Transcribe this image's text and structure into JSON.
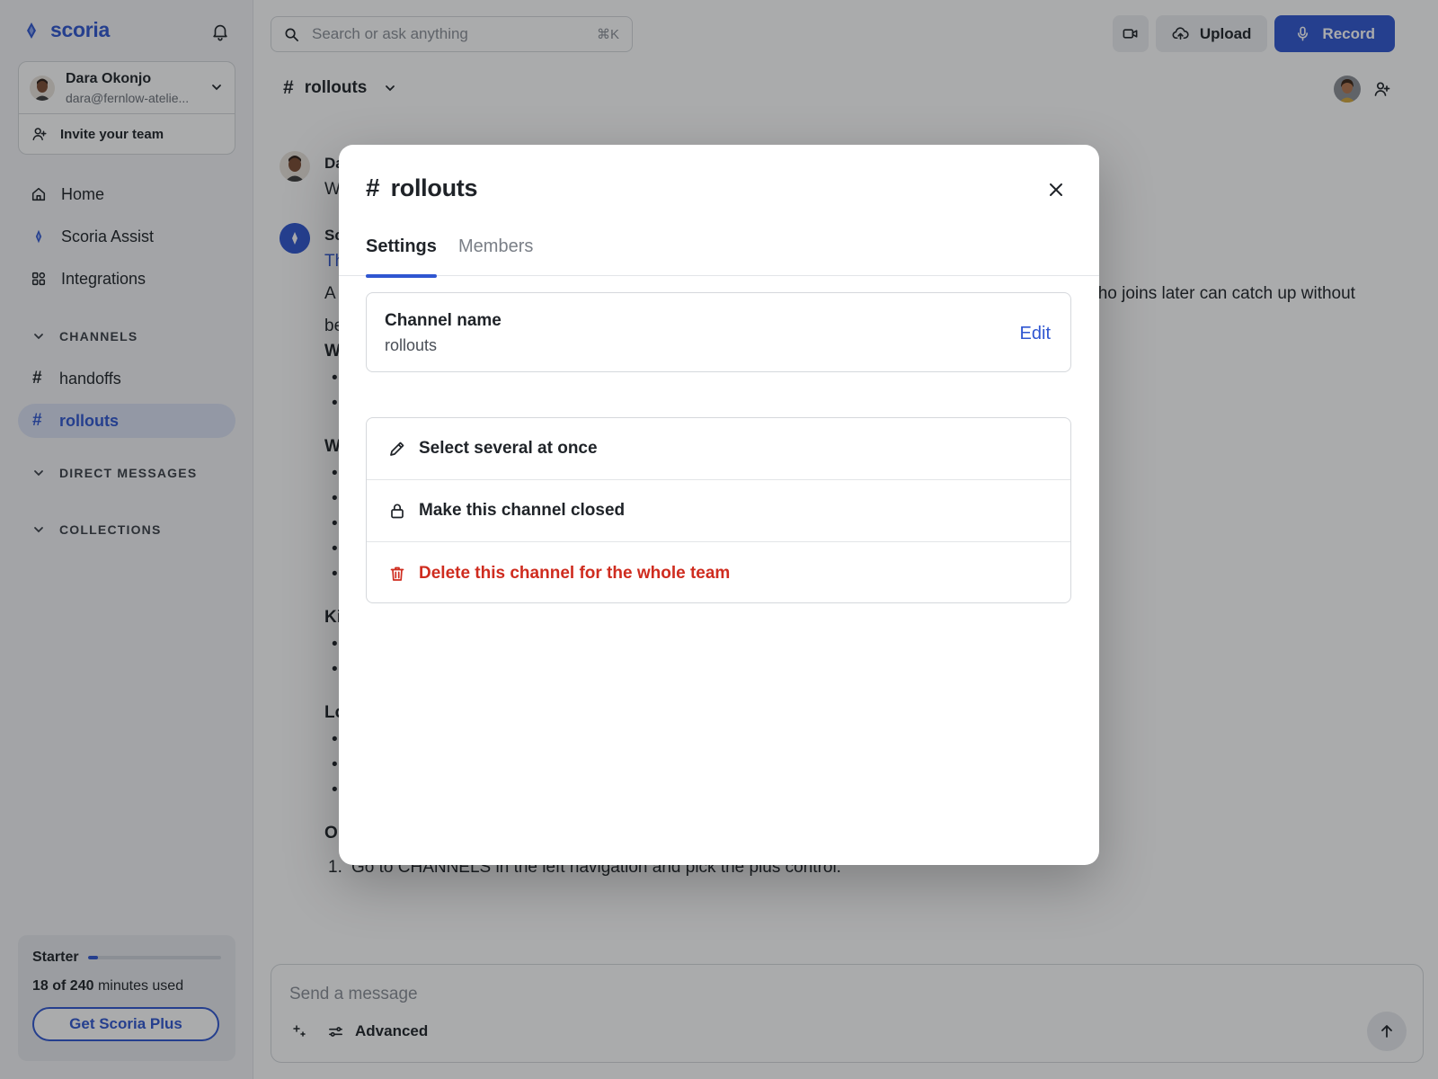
{
  "app": {
    "brand": "scoria"
  },
  "account": {
    "name": "Dara Okonjo",
    "email": "dara@fernlow-atelie...",
    "invite_label": "Invite your team"
  },
  "nav": {
    "items": [
      {
        "label": "Home",
        "icon": "home-icon"
      },
      {
        "label": "Scoria Assist",
        "icon": "sparkle-icon"
      },
      {
        "label": "Integrations",
        "icon": "grid-icon"
      }
    ]
  },
  "sections": {
    "channels": "CHANNELS",
    "direct_messages": "DIRECT MESSAGES",
    "collections": "COLLECTIONS"
  },
  "channels": [
    {
      "label": "handoffs",
      "active": false
    },
    {
      "label": "rollouts",
      "active": true
    }
  ],
  "plan": {
    "name": "Starter",
    "used": "18 of 240",
    "suffix": "minutes used",
    "progress": 0.075,
    "cta": "Get Scoria Plus"
  },
  "search": {
    "placeholder": "Search or ask anything",
    "shortcut": "⌘K"
  },
  "toolbar": {
    "upload_label": "Upload",
    "record_label": "Record"
  },
  "channel_header": {
    "hash": "#",
    "name": "rollouts"
  },
  "feed": {
    "msg1": {
      "author_fragment": "Da",
      "text_fragment": "W"
    },
    "msg2": {
      "author_fragment": "Sc",
      "link_fragment": "Th",
      "line1_start": "A",
      "line1_end": "who joins later can catch up without",
      "line2_start": "be",
      "headings": [
        "W",
        "W",
        "Ki",
        "Lo",
        "O"
      ],
      "numbered_item": "Go to CHANNELS in the left navigation and pick the plus control.",
      "numbered_index": "1."
    }
  },
  "composer": {
    "placeholder": "Send a message",
    "advanced_label": "Advanced"
  },
  "modal": {
    "hash": "#",
    "title": "rollouts",
    "tabs": [
      {
        "label": "Settings",
        "active": true
      },
      {
        "label": "Members",
        "active": false
      }
    ],
    "channel_name_label": "Channel name",
    "channel_name_value": "rollouts",
    "edit_label": "Edit",
    "actions": [
      {
        "label": "Select several at once",
        "icon": "pencil-icon",
        "danger": false
      },
      {
        "label": "Make this channel closed",
        "icon": "lock-icon",
        "danger": false
      },
      {
        "label": "Delete this channel for the whole team",
        "icon": "trash-icon",
        "danger": true
      }
    ]
  },
  "colors": {
    "accent": "#2f56d1",
    "danger": "#cf2c1f",
    "active_channel_bg": "#dbe2f4"
  }
}
